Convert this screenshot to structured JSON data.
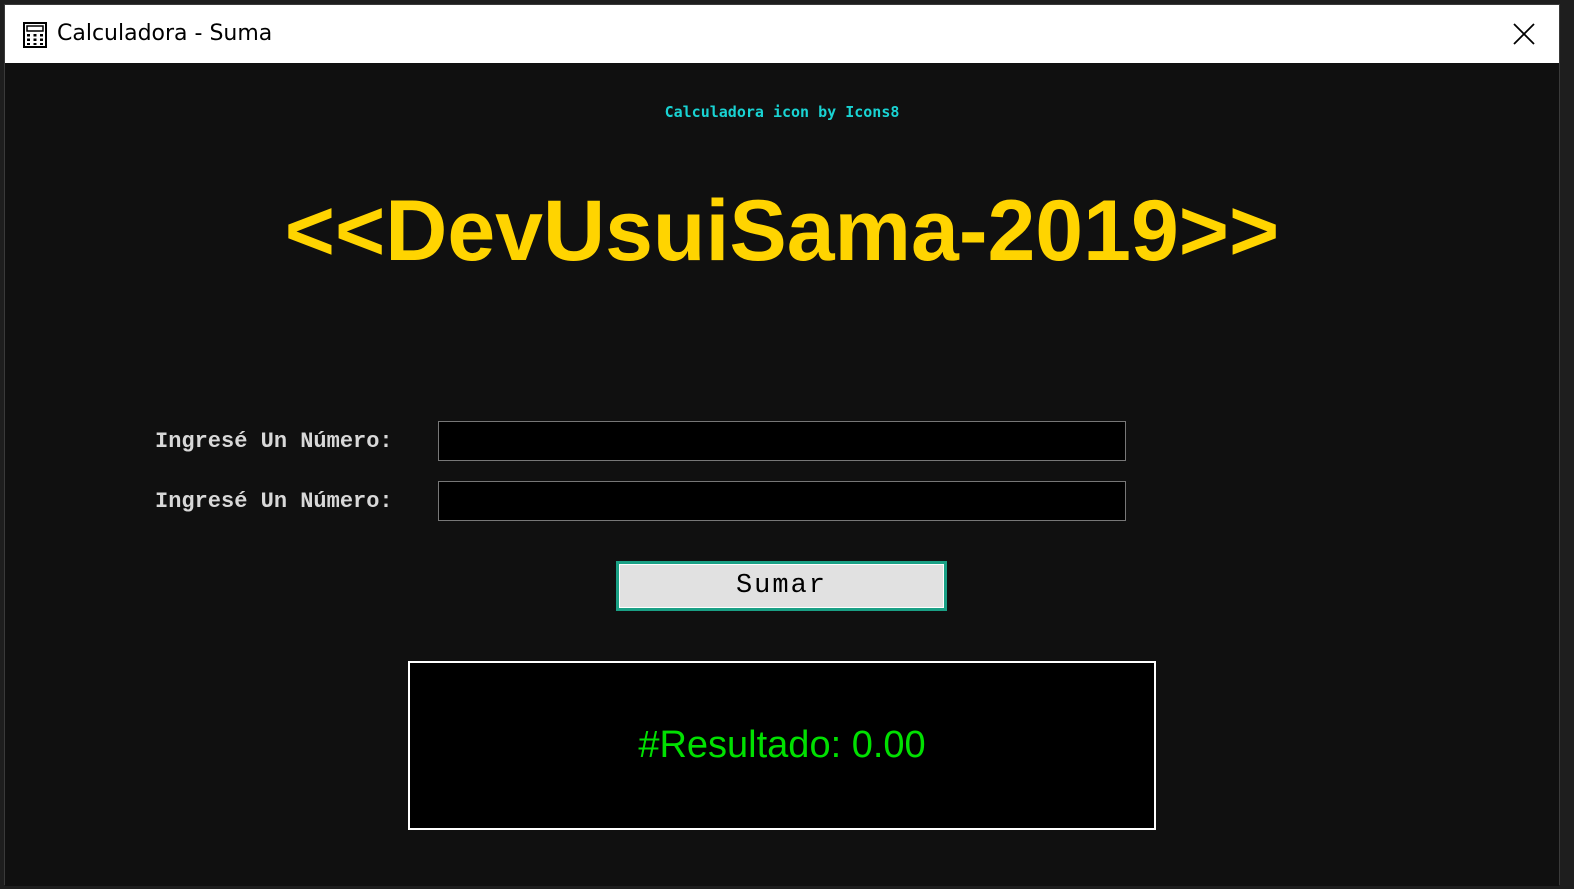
{
  "window": {
    "title": "Calculadora - Suma",
    "icon": "calculator-icon",
    "close_icon": "close-icon"
  },
  "credit": "Calculadora icon by Icons8",
  "brand": "<<DevUsuiSama-2019>>",
  "fields": [
    {
      "label": "Ingresé Un Número:",
      "value": ""
    },
    {
      "label": "Ingresé Un Número:",
      "value": ""
    }
  ],
  "button": {
    "label": "Sumar"
  },
  "result": {
    "text": "#Resultado: 0.00"
  },
  "colors": {
    "background": "#101010",
    "credit": "#19d3d3",
    "brand": "#ffd400",
    "label": "#d8d8d8",
    "button_border": "#1aa085",
    "result_text": "#00e000"
  }
}
